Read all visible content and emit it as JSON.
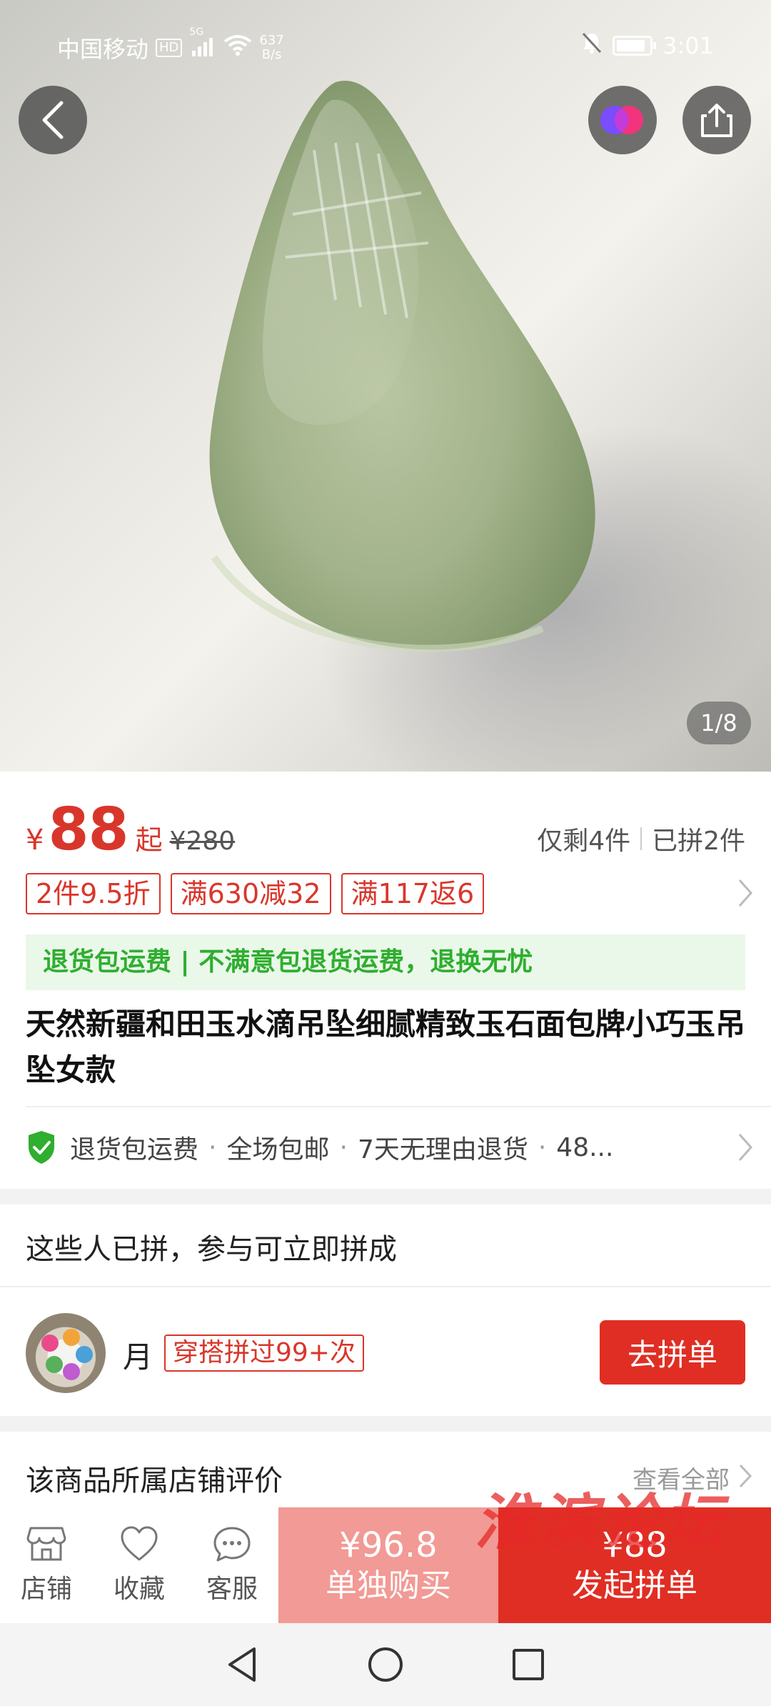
{
  "status_bar": {
    "carrier": "中国移动",
    "hd_badge": "HD",
    "signal_label": "5G",
    "net_speed_value": "637",
    "net_speed_unit": "B/s",
    "time": "3:01",
    "battery_level": 0.8
  },
  "gallery": {
    "counter": "1/8"
  },
  "price": {
    "currency": "¥",
    "current": "88",
    "suffix": "起",
    "original": "¥280",
    "remaining": "仅剩4件",
    "joined": "已拼2件"
  },
  "coupons": [
    "2件9.5折",
    "满630减32",
    "满117返6"
  ],
  "guarantee_banner": "退货包运费 | 不满意包退货运费，退换无忧",
  "product_title": "天然新疆和田玉水滴吊坠细腻精致玉石面包牌小巧玉吊坠女款",
  "services": [
    "退货包运费",
    "全场包邮",
    "7天无理由退货",
    "48..."
  ],
  "group": {
    "title": "这些人已拼，参与可立即拼成",
    "user_name": "月",
    "user_tag": "穿搭拼过99+次",
    "join_label": "去拼单"
  },
  "review": {
    "title": "该商品所属店铺评价",
    "view_all": "查看全部"
  },
  "bottom_bar": {
    "tabs": [
      {
        "label": "店铺",
        "icon": "store-icon"
      },
      {
        "label": "收藏",
        "icon": "heart-icon"
      },
      {
        "label": "客服",
        "icon": "chat-icon"
      }
    ],
    "solo_price": "¥96.8",
    "solo_label": "单独购买",
    "group_price": "¥88",
    "group_label": "发起拼单"
  },
  "watermark": "淮滨论坛",
  "colors": {
    "accent_red": "#e02e24",
    "price_red": "#d9362b",
    "guarantee_green": "#2fae2f",
    "solo_pink": "#f29a95"
  }
}
